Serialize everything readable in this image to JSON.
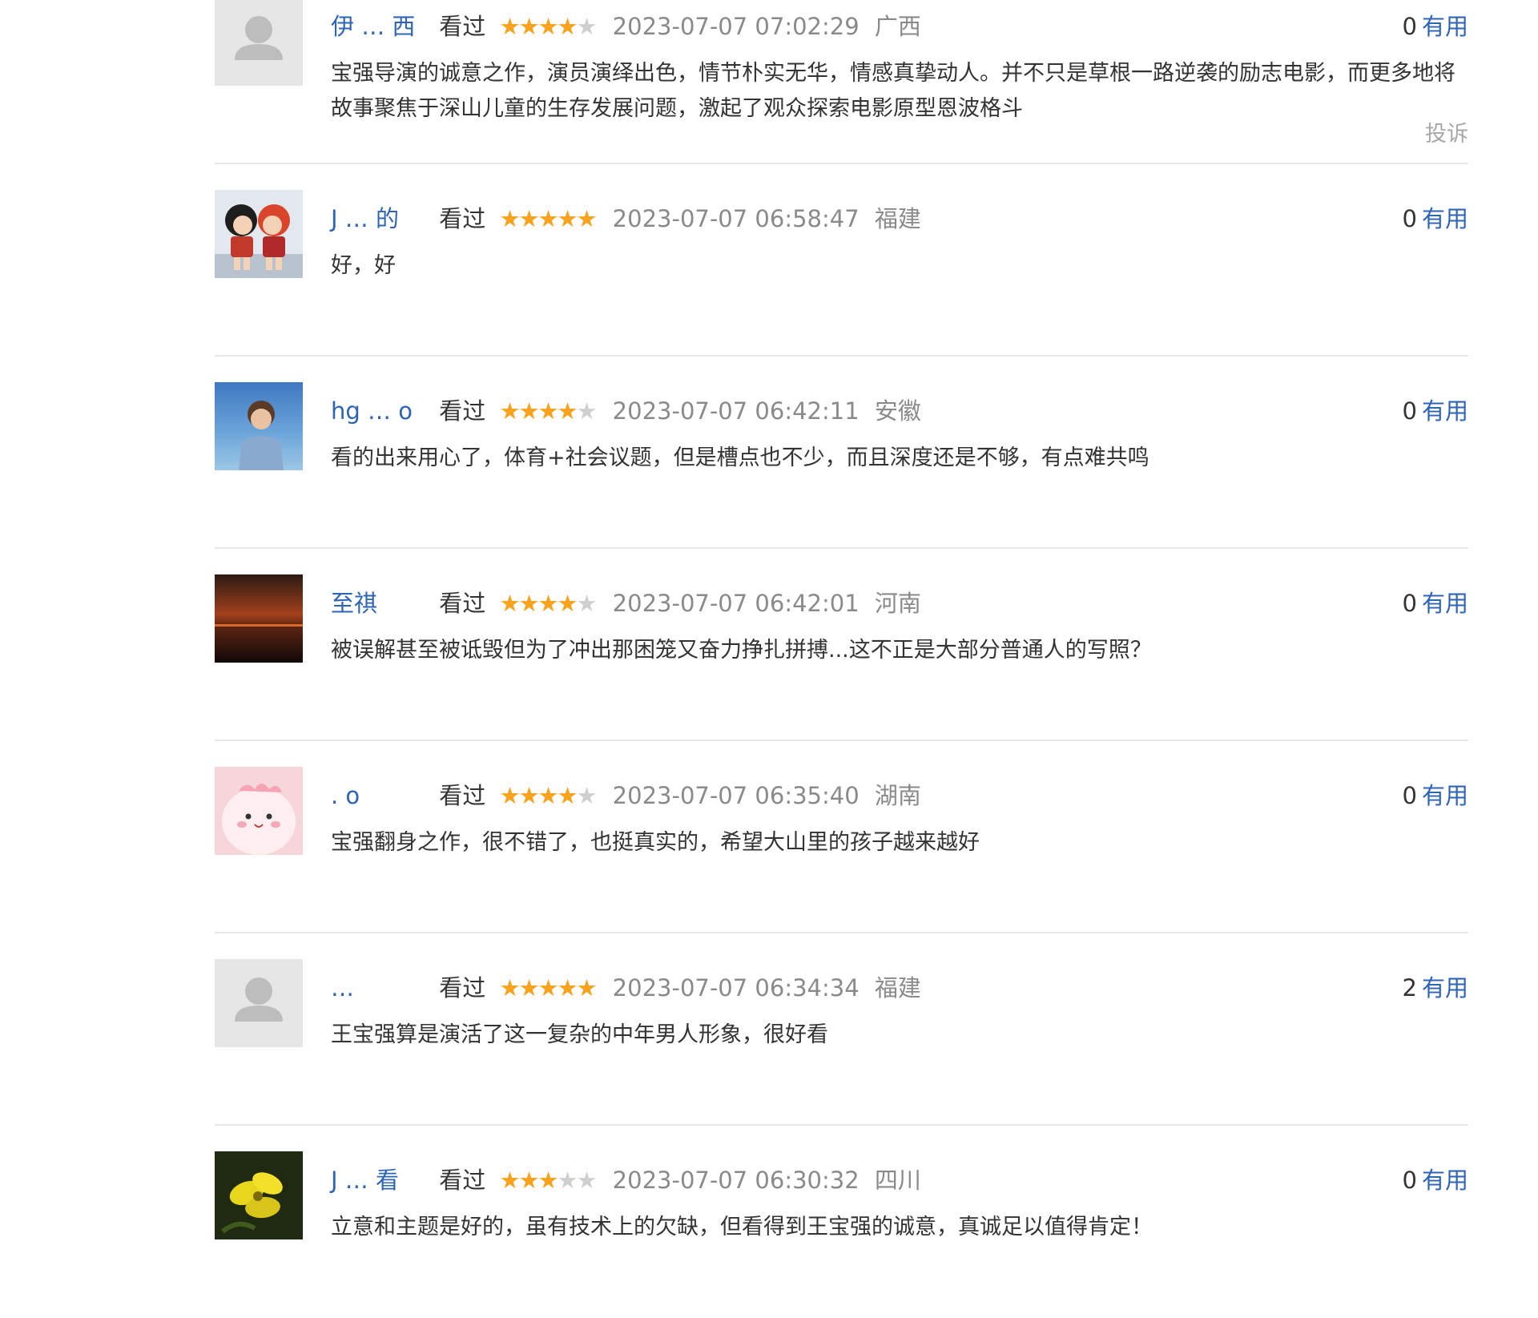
{
  "reviews": [
    {
      "username": "伊 … 西",
      "watched": "看过",
      "rating": 4,
      "time": "2023-07-07 07:02:29",
      "region": "广西",
      "useful_count": "0",
      "useful_label": "有用",
      "content": "宝强导演的诚意之作，演员演绎出色，情节朴实无华，情感真挚动人。并不只是草根一路逆袭的励志电影，而更多地将故事聚焦于深山儿童的生存发展问题，激起了观众探索电影原型恩波格斗",
      "report": "投诉",
      "avatar": "default-avatar"
    },
    {
      "username": "J … 的",
      "watched": "看过",
      "rating": 5,
      "time": "2023-07-07 06:58:47",
      "region": "福建",
      "useful_count": "0",
      "useful_label": "有用",
      "content": "好，好",
      "avatar": "cartoon-avatar"
    },
    {
      "username": "hg … o",
      "watched": "看过",
      "rating": 4,
      "time": "2023-07-07 06:42:11",
      "region": "安徽",
      "useful_count": "0",
      "useful_label": "有用",
      "content": "看的出来用心了，体育+社会议题，但是槽点也不少，而且深度还是不够，有点难共鸣",
      "avatar": "photo-avatar"
    },
    {
      "username": "至祺",
      "watched": "看过",
      "rating": 4,
      "time": "2023-07-07 06:42:01",
      "region": "河南",
      "useful_count": "0",
      "useful_label": "有用",
      "content": "被误解甚至被诋毁但为了冲出那困笼又奋力挣扎拼搏...这不正是大部分普通人的写照？",
      "avatar": "sunset-avatar"
    },
    {
      "username": ". o",
      "watched": "看过",
      "rating": 4,
      "time": "2023-07-07 06:35:40",
      "region": "湖南",
      "useful_count": "0",
      "useful_label": "有用",
      "content": "宝强翻身之作，很不错了，也挺真实的，希望大山里的孩子越来越好",
      "avatar": "pink-cartoon-avatar"
    },
    {
      "username": "…",
      "watched": "看过",
      "rating": 5,
      "time": "2023-07-07 06:34:34",
      "region": "福建",
      "useful_count": "2",
      "useful_label": "有用",
      "content": "王宝强算是演活了这一复杂的中年男人形象，很好看",
      "avatar": "default-avatar"
    },
    {
      "username": "J … 看",
      "watched": "看过",
      "rating": 3,
      "time": "2023-07-07 06:30:32",
      "region": "四川",
      "useful_count": "0",
      "useful_label": "有用",
      "content": "立意和主题是好的，虽有技术上的欠缺，但看得到王宝强的诚意，真诚足以值得肯定！",
      "avatar": "flower-avatar"
    }
  ],
  "colors": {
    "link": "#2d64b3",
    "star_on": "#f7a21b",
    "star_off": "#cfcfcf",
    "meta_gray": "#8a8a8a",
    "divider": "#e8e8e8"
  }
}
